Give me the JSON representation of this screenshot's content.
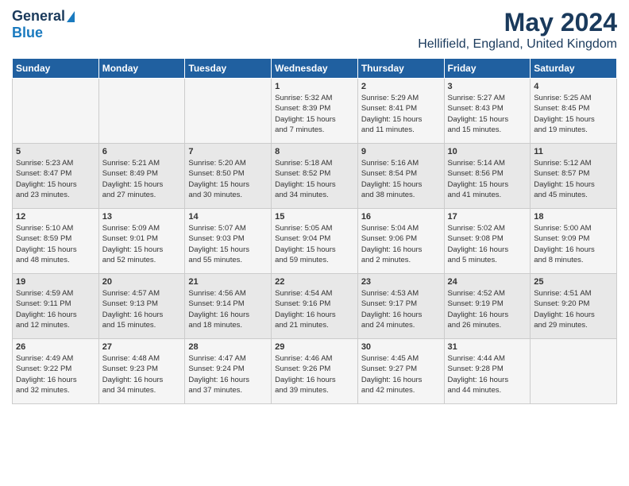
{
  "logo": {
    "general": "General",
    "blue": "Blue"
  },
  "title": "May 2024",
  "subtitle": "Hellifield, England, United Kingdom",
  "days_of_week": [
    "Sunday",
    "Monday",
    "Tuesday",
    "Wednesday",
    "Thursday",
    "Friday",
    "Saturday"
  ],
  "weeks": [
    [
      {
        "day": "",
        "info": ""
      },
      {
        "day": "",
        "info": ""
      },
      {
        "day": "",
        "info": ""
      },
      {
        "day": "1",
        "info": "Sunrise: 5:32 AM\nSunset: 8:39 PM\nDaylight: 15 hours\nand 7 minutes."
      },
      {
        "day": "2",
        "info": "Sunrise: 5:29 AM\nSunset: 8:41 PM\nDaylight: 15 hours\nand 11 minutes."
      },
      {
        "day": "3",
        "info": "Sunrise: 5:27 AM\nSunset: 8:43 PM\nDaylight: 15 hours\nand 15 minutes."
      },
      {
        "day": "4",
        "info": "Sunrise: 5:25 AM\nSunset: 8:45 PM\nDaylight: 15 hours\nand 19 minutes."
      }
    ],
    [
      {
        "day": "5",
        "info": "Sunrise: 5:23 AM\nSunset: 8:47 PM\nDaylight: 15 hours\nand 23 minutes."
      },
      {
        "day": "6",
        "info": "Sunrise: 5:21 AM\nSunset: 8:49 PM\nDaylight: 15 hours\nand 27 minutes."
      },
      {
        "day": "7",
        "info": "Sunrise: 5:20 AM\nSunset: 8:50 PM\nDaylight: 15 hours\nand 30 minutes."
      },
      {
        "day": "8",
        "info": "Sunrise: 5:18 AM\nSunset: 8:52 PM\nDaylight: 15 hours\nand 34 minutes."
      },
      {
        "day": "9",
        "info": "Sunrise: 5:16 AM\nSunset: 8:54 PM\nDaylight: 15 hours\nand 38 minutes."
      },
      {
        "day": "10",
        "info": "Sunrise: 5:14 AM\nSunset: 8:56 PM\nDaylight: 15 hours\nand 41 minutes."
      },
      {
        "day": "11",
        "info": "Sunrise: 5:12 AM\nSunset: 8:57 PM\nDaylight: 15 hours\nand 45 minutes."
      }
    ],
    [
      {
        "day": "12",
        "info": "Sunrise: 5:10 AM\nSunset: 8:59 PM\nDaylight: 15 hours\nand 48 minutes."
      },
      {
        "day": "13",
        "info": "Sunrise: 5:09 AM\nSunset: 9:01 PM\nDaylight: 15 hours\nand 52 minutes."
      },
      {
        "day": "14",
        "info": "Sunrise: 5:07 AM\nSunset: 9:03 PM\nDaylight: 15 hours\nand 55 minutes."
      },
      {
        "day": "15",
        "info": "Sunrise: 5:05 AM\nSunset: 9:04 PM\nDaylight: 15 hours\nand 59 minutes."
      },
      {
        "day": "16",
        "info": "Sunrise: 5:04 AM\nSunset: 9:06 PM\nDaylight: 16 hours\nand 2 minutes."
      },
      {
        "day": "17",
        "info": "Sunrise: 5:02 AM\nSunset: 9:08 PM\nDaylight: 16 hours\nand 5 minutes."
      },
      {
        "day": "18",
        "info": "Sunrise: 5:00 AM\nSunset: 9:09 PM\nDaylight: 16 hours\nand 8 minutes."
      }
    ],
    [
      {
        "day": "19",
        "info": "Sunrise: 4:59 AM\nSunset: 9:11 PM\nDaylight: 16 hours\nand 12 minutes."
      },
      {
        "day": "20",
        "info": "Sunrise: 4:57 AM\nSunset: 9:13 PM\nDaylight: 16 hours\nand 15 minutes."
      },
      {
        "day": "21",
        "info": "Sunrise: 4:56 AM\nSunset: 9:14 PM\nDaylight: 16 hours\nand 18 minutes."
      },
      {
        "day": "22",
        "info": "Sunrise: 4:54 AM\nSunset: 9:16 PM\nDaylight: 16 hours\nand 21 minutes."
      },
      {
        "day": "23",
        "info": "Sunrise: 4:53 AM\nSunset: 9:17 PM\nDaylight: 16 hours\nand 24 minutes."
      },
      {
        "day": "24",
        "info": "Sunrise: 4:52 AM\nSunset: 9:19 PM\nDaylight: 16 hours\nand 26 minutes."
      },
      {
        "day": "25",
        "info": "Sunrise: 4:51 AM\nSunset: 9:20 PM\nDaylight: 16 hours\nand 29 minutes."
      }
    ],
    [
      {
        "day": "26",
        "info": "Sunrise: 4:49 AM\nSunset: 9:22 PM\nDaylight: 16 hours\nand 32 minutes."
      },
      {
        "day": "27",
        "info": "Sunrise: 4:48 AM\nSunset: 9:23 PM\nDaylight: 16 hours\nand 34 minutes."
      },
      {
        "day": "28",
        "info": "Sunrise: 4:47 AM\nSunset: 9:24 PM\nDaylight: 16 hours\nand 37 minutes."
      },
      {
        "day": "29",
        "info": "Sunrise: 4:46 AM\nSunset: 9:26 PM\nDaylight: 16 hours\nand 39 minutes."
      },
      {
        "day": "30",
        "info": "Sunrise: 4:45 AM\nSunset: 9:27 PM\nDaylight: 16 hours\nand 42 minutes."
      },
      {
        "day": "31",
        "info": "Sunrise: 4:44 AM\nSunset: 9:28 PM\nDaylight: 16 hours\nand 44 minutes."
      },
      {
        "day": "",
        "info": ""
      }
    ]
  ]
}
